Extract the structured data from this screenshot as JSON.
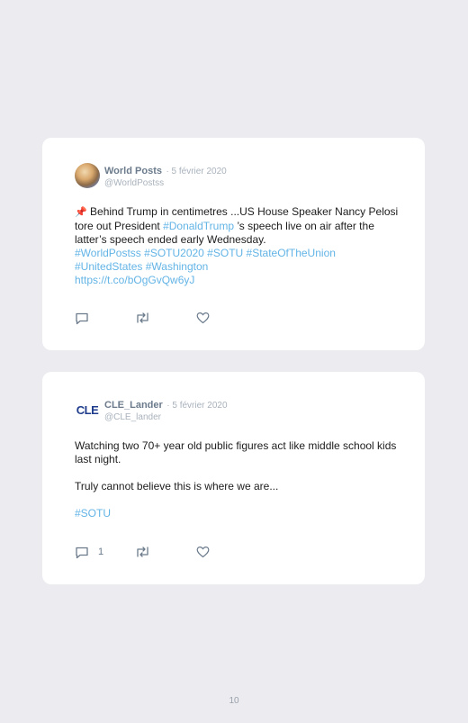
{
  "tweets": [
    {
      "name": "World Posts",
      "date": "· 5 février 2020",
      "handle": "@WorldPostss",
      "pin": "📌",
      "text_plain": " Behind Trump in centimetres ...US House Speaker Nancy Pelosi tore out President ",
      "mention": "#DonaldTrump",
      "text_after": " ’s speech live on air after the latter’s speech ended early Wednesday.",
      "hashtags_line1": "#WorldPostss #SOTU2020 #SOTU #StateOfTheUnion",
      "hashtags_line2": "#UnitedStates #Washington",
      "link": "https://t.co/bOgGvQw6yJ",
      "reply_count": "",
      "retweet_count": "",
      "like_count": ""
    },
    {
      "name": "CLE_Lander",
      "date": "· 5 février 2020",
      "handle": "@CLE_lander",
      "avatar_text": "CLE",
      "line1": "Watching two 70+ year old public figures act like middle school kids last night.",
      "line2": "Truly cannot believe this is where we are...",
      "hashtag": "#SOTU",
      "reply_count": "1",
      "retweet_count": "",
      "like_count": ""
    }
  ],
  "page_number": "10",
  "colors": {
    "background": "#ebebf0",
    "card": "#ffffff",
    "link": "#63b4e6",
    "name": "#6b7b8c",
    "meta": "#a9b2bc"
  },
  "icons": [
    "reply-icon",
    "retweet-icon",
    "like-icon"
  ]
}
